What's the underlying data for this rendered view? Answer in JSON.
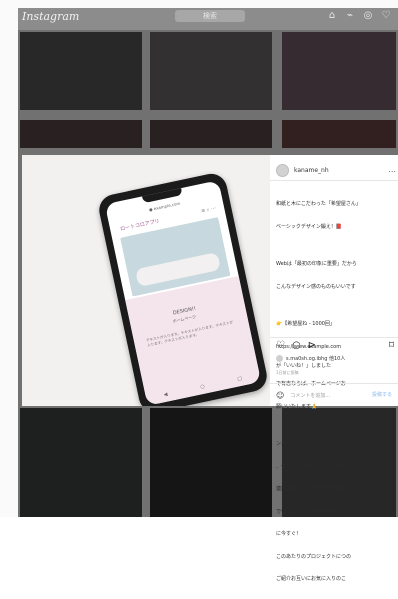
{
  "app": {
    "brand": "Instagram",
    "search_placeholder": "検索"
  },
  "nav": {
    "icons": [
      "home-icon",
      "messages-icon",
      "explore-icon",
      "heart-icon"
    ]
  },
  "post": {
    "username": "kaname_nh",
    "more_label": "...",
    "caption_lines": [
      "和紙と木にこだわった「希望屋さん」",
      "ベーシックデザイン鍛え！📕",
      "",
      "Webは「最初の印象に重要」だから",
      "こんなデザイン感のものもいいです",
      "",
      "👉【希望屋ね - 1000回」",
      "https://www.example.com",
      "",
      "で有志ならば、ホームページお",
      "願いいたします🙏",
      "",
      "ンバーネクストにつないでさせて",
      "、今すぐでアカウントデータが",
      "連携ご都合で、ぜひ有志で希望",
      "でいただいた方を今日のカンバ",
      "に今すぐ！",
      "このあたりのプロジェクトにつの",
      "ご紹介お互いにお気に入りのこ"
    ],
    "actions": [
      "heart-icon",
      "comment-icon",
      "share-icon",
      "bookmark-icon"
    ],
    "likes_text": "s.ma0sh.og.ibhg 他10人",
    "likes_sub": "が「いいね！」しました",
    "date": "1日前に投稿",
    "comment_placeholder": "コメントを追加...",
    "post_label": "投稿する"
  },
  "phone_screen": {
    "browser_url": "● example.com",
    "site_title": "ロートコロアプリ",
    "site_icons": "≡  ⌕  ⋯",
    "heading": "DESIGN!!",
    "subheading": "ホームページ",
    "body_text": "テキストが入ります。テキストが入ります。テキストが入ります。テキストが入ります。",
    "bottom_icons": [
      "◀",
      "○",
      "▢"
    ]
  },
  "colors": {
    "frame_bg": "#fafafa",
    "overlay": "rgba(0,0,0,0.55)",
    "text": "#262626",
    "link_blue": "#8bb7f0",
    "site_pink": "#a4548f"
  }
}
